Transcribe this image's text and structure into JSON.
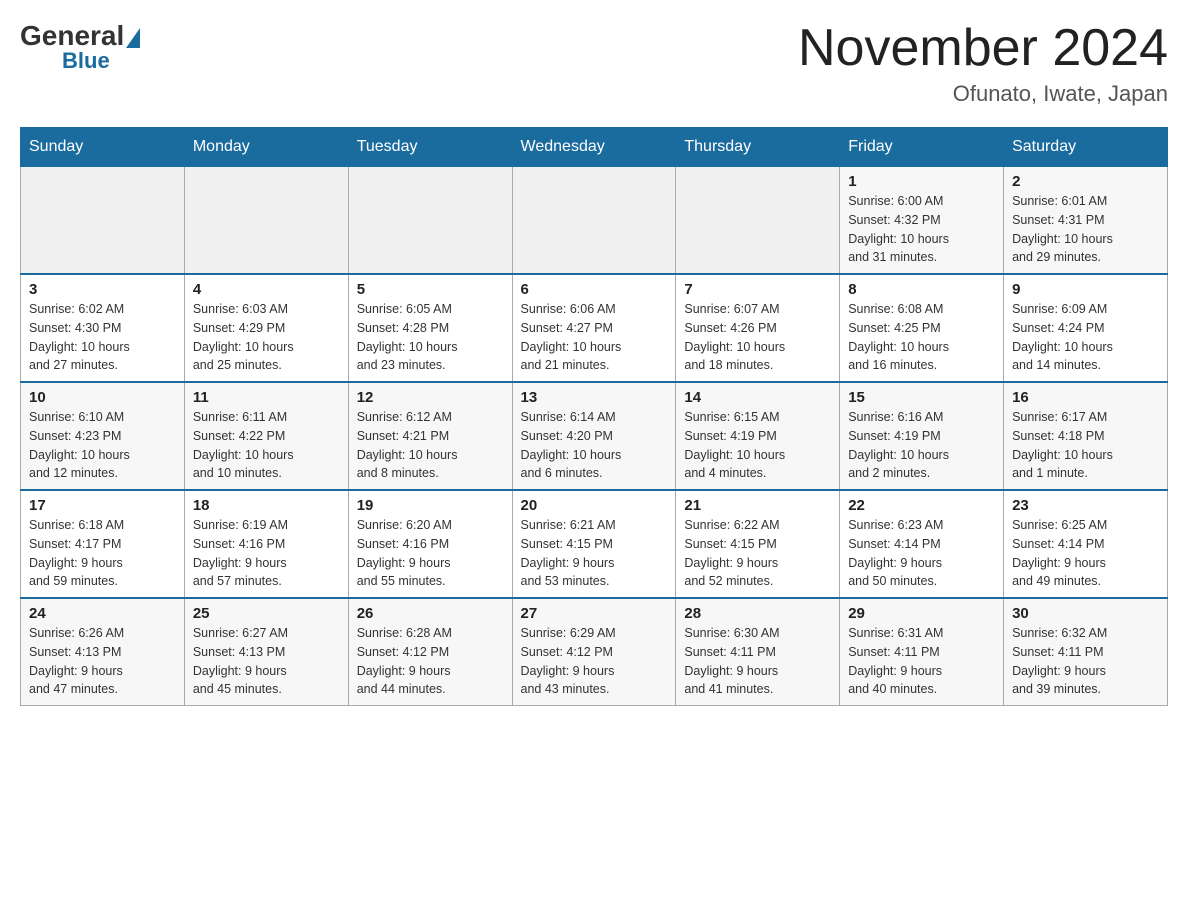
{
  "header": {
    "logo_general": "General",
    "logo_blue": "Blue",
    "month_title": "November 2024",
    "location": "Ofunato, Iwate, Japan"
  },
  "weekdays": [
    "Sunday",
    "Monday",
    "Tuesday",
    "Wednesday",
    "Thursday",
    "Friday",
    "Saturday"
  ],
  "weeks": [
    [
      {
        "day": "",
        "info": ""
      },
      {
        "day": "",
        "info": ""
      },
      {
        "day": "",
        "info": ""
      },
      {
        "day": "",
        "info": ""
      },
      {
        "day": "",
        "info": ""
      },
      {
        "day": "1",
        "info": "Sunrise: 6:00 AM\nSunset: 4:32 PM\nDaylight: 10 hours\nand 31 minutes."
      },
      {
        "day": "2",
        "info": "Sunrise: 6:01 AM\nSunset: 4:31 PM\nDaylight: 10 hours\nand 29 minutes."
      }
    ],
    [
      {
        "day": "3",
        "info": "Sunrise: 6:02 AM\nSunset: 4:30 PM\nDaylight: 10 hours\nand 27 minutes."
      },
      {
        "day": "4",
        "info": "Sunrise: 6:03 AM\nSunset: 4:29 PM\nDaylight: 10 hours\nand 25 minutes."
      },
      {
        "day": "5",
        "info": "Sunrise: 6:05 AM\nSunset: 4:28 PM\nDaylight: 10 hours\nand 23 minutes."
      },
      {
        "day": "6",
        "info": "Sunrise: 6:06 AM\nSunset: 4:27 PM\nDaylight: 10 hours\nand 21 minutes."
      },
      {
        "day": "7",
        "info": "Sunrise: 6:07 AM\nSunset: 4:26 PM\nDaylight: 10 hours\nand 18 minutes."
      },
      {
        "day": "8",
        "info": "Sunrise: 6:08 AM\nSunset: 4:25 PM\nDaylight: 10 hours\nand 16 minutes."
      },
      {
        "day": "9",
        "info": "Sunrise: 6:09 AM\nSunset: 4:24 PM\nDaylight: 10 hours\nand 14 minutes."
      }
    ],
    [
      {
        "day": "10",
        "info": "Sunrise: 6:10 AM\nSunset: 4:23 PM\nDaylight: 10 hours\nand 12 minutes."
      },
      {
        "day": "11",
        "info": "Sunrise: 6:11 AM\nSunset: 4:22 PM\nDaylight: 10 hours\nand 10 minutes."
      },
      {
        "day": "12",
        "info": "Sunrise: 6:12 AM\nSunset: 4:21 PM\nDaylight: 10 hours\nand 8 minutes."
      },
      {
        "day": "13",
        "info": "Sunrise: 6:14 AM\nSunset: 4:20 PM\nDaylight: 10 hours\nand 6 minutes."
      },
      {
        "day": "14",
        "info": "Sunrise: 6:15 AM\nSunset: 4:19 PM\nDaylight: 10 hours\nand 4 minutes."
      },
      {
        "day": "15",
        "info": "Sunrise: 6:16 AM\nSunset: 4:19 PM\nDaylight: 10 hours\nand 2 minutes."
      },
      {
        "day": "16",
        "info": "Sunrise: 6:17 AM\nSunset: 4:18 PM\nDaylight: 10 hours\nand 1 minute."
      }
    ],
    [
      {
        "day": "17",
        "info": "Sunrise: 6:18 AM\nSunset: 4:17 PM\nDaylight: 9 hours\nand 59 minutes."
      },
      {
        "day": "18",
        "info": "Sunrise: 6:19 AM\nSunset: 4:16 PM\nDaylight: 9 hours\nand 57 minutes."
      },
      {
        "day": "19",
        "info": "Sunrise: 6:20 AM\nSunset: 4:16 PM\nDaylight: 9 hours\nand 55 minutes."
      },
      {
        "day": "20",
        "info": "Sunrise: 6:21 AM\nSunset: 4:15 PM\nDaylight: 9 hours\nand 53 minutes."
      },
      {
        "day": "21",
        "info": "Sunrise: 6:22 AM\nSunset: 4:15 PM\nDaylight: 9 hours\nand 52 minutes."
      },
      {
        "day": "22",
        "info": "Sunrise: 6:23 AM\nSunset: 4:14 PM\nDaylight: 9 hours\nand 50 minutes."
      },
      {
        "day": "23",
        "info": "Sunrise: 6:25 AM\nSunset: 4:14 PM\nDaylight: 9 hours\nand 49 minutes."
      }
    ],
    [
      {
        "day": "24",
        "info": "Sunrise: 6:26 AM\nSunset: 4:13 PM\nDaylight: 9 hours\nand 47 minutes."
      },
      {
        "day": "25",
        "info": "Sunrise: 6:27 AM\nSunset: 4:13 PM\nDaylight: 9 hours\nand 45 minutes."
      },
      {
        "day": "26",
        "info": "Sunrise: 6:28 AM\nSunset: 4:12 PM\nDaylight: 9 hours\nand 44 minutes."
      },
      {
        "day": "27",
        "info": "Sunrise: 6:29 AM\nSunset: 4:12 PM\nDaylight: 9 hours\nand 43 minutes."
      },
      {
        "day": "28",
        "info": "Sunrise: 6:30 AM\nSunset: 4:11 PM\nDaylight: 9 hours\nand 41 minutes."
      },
      {
        "day": "29",
        "info": "Sunrise: 6:31 AM\nSunset: 4:11 PM\nDaylight: 9 hours\nand 40 minutes."
      },
      {
        "day": "30",
        "info": "Sunrise: 6:32 AM\nSunset: 4:11 PM\nDaylight: 9 hours\nand 39 minutes."
      }
    ]
  ]
}
